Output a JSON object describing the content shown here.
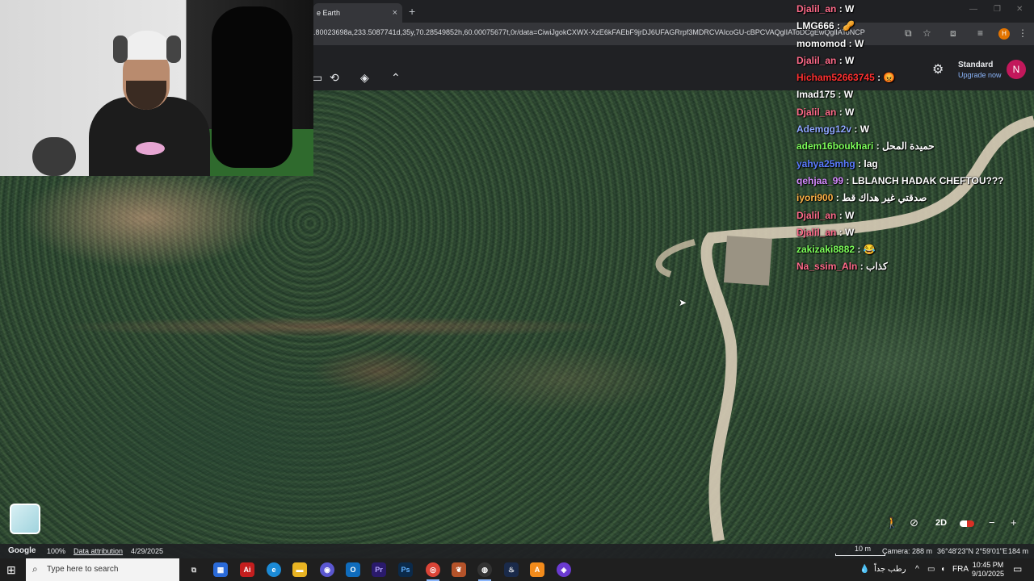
{
  "browser": {
    "tab_title": "e Earth",
    "tab_close": "×",
    "new_tab": "+",
    "url": ".80023698a,233.5087741d,35y,70.28549852h,60.00075677t,0r/data=CiwiJgokCXWX-XzE6kFAEbF9jrDJ6UFAGRrpf3MDRCVAIcoGU-cBPCVAQglIAToDCgEwQglIAToNCP",
    "profile_initial": "H"
  },
  "earth_toolbar": {
    "plan_title": "Standard",
    "plan_sub": "Upgrade now",
    "user_initial": "N"
  },
  "chat": [
    {
      "user": "Djalil_an",
      "color": "#ff6b8a",
      "msg": "W"
    },
    {
      "user": "LMG666",
      "color": "#ffffff",
      "msg": "🥜"
    },
    {
      "user": "momomod",
      "color": "#ffffff",
      "msg": "W"
    },
    {
      "user": "Djalil_an",
      "color": "#ff6b8a",
      "msg": "W"
    },
    {
      "user": "Hicham52663745",
      "color": "#ff3030",
      "msg": "😡"
    },
    {
      "user": "Imad175",
      "color": "#ffffff",
      "msg": "W"
    },
    {
      "user": "Djalil_an",
      "color": "#ff6b8a",
      "msg": "W"
    },
    {
      "user": "Ademgg12v",
      "color": "#8fa8ff",
      "msg": "W"
    },
    {
      "user": "adem16boukhari",
      "color": "#7dff5a",
      "msg": "حميدة المحل"
    },
    {
      "user": "yahya25mhg",
      "color": "#5a7bff",
      "msg": "lag"
    },
    {
      "user": "qehjaa_99",
      "color": "#d58cff",
      "msg": "LBLANCH HADAK CHEFTOU???"
    },
    {
      "user": "iyori900",
      "color": "#ffb347",
      "msg": "صدقتي غير هداك قط"
    },
    {
      "user": "Djalil_an",
      "color": "#ff6b8a",
      "msg": "W"
    },
    {
      "user": "Djalil_an",
      "color": "#ff6b8a",
      "msg": "W"
    },
    {
      "user": "zakizaki8882",
      "color": "#7dff5a",
      "msg": "😂"
    },
    {
      "user": "Na_ssim_Aln",
      "color": "#ff6b8a",
      "msg": "كذاب"
    }
  ],
  "map_controls": {
    "mode_2d": "2D"
  },
  "status_bar": {
    "google": "Google",
    "zoom": "100%",
    "attribution": "Data attribution",
    "date": "4/29/2025",
    "scale": "10 m",
    "camera": "Camera: 288 m",
    "coords": "36°48'23\"N 2°59'01\"E",
    "elevation": "184 m"
  },
  "taskbar": {
    "search_placeholder": "Type here to search",
    "weather": "رطب جداً",
    "lang": "FRA",
    "time": "10:45 PM",
    "date": "9/10/2025"
  },
  "colors": {
    "chrome_bg": "#202124",
    "taskbar_bg": "#1f1f1f",
    "accent_link": "#8ab4f8",
    "avatar_pink": "#c2185b"
  }
}
